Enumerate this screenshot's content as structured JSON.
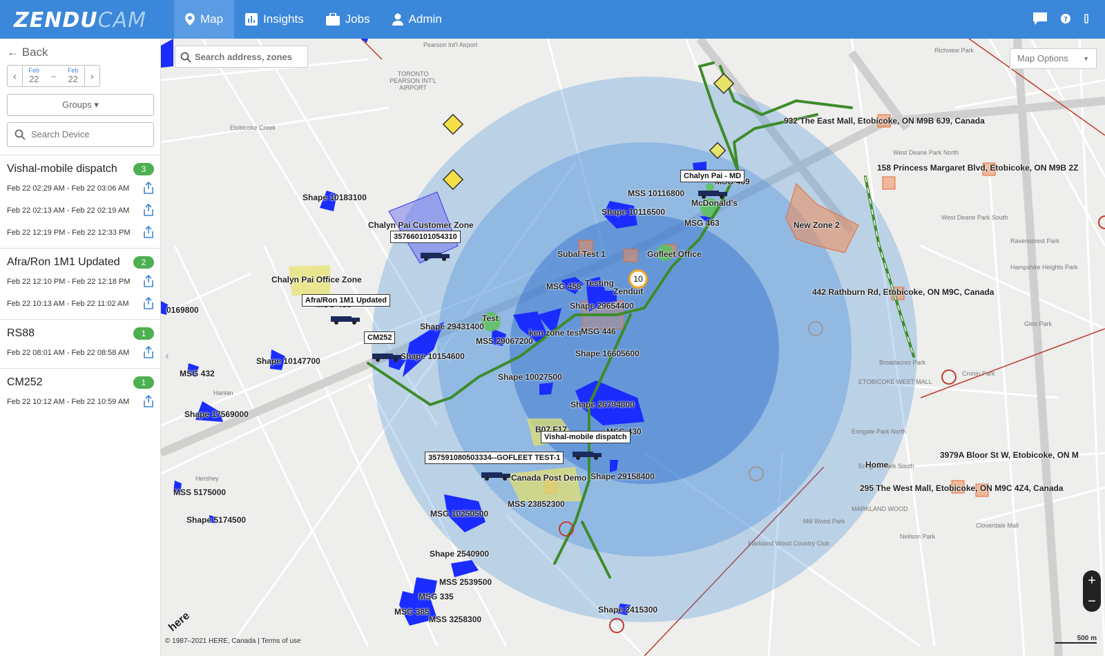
{
  "brand": {
    "name1": "ZENDU",
    "name2": "CAM"
  },
  "nav": [
    {
      "label": "Map",
      "icon": "map-pin-icon"
    },
    {
      "label": "Insights",
      "icon": "bar-chart-icon"
    },
    {
      "label": "Jobs",
      "icon": "briefcase-icon"
    },
    {
      "label": "Admin",
      "icon": "user-icon"
    }
  ],
  "sidebar": {
    "back_label": "Back",
    "date_from": {
      "month": "Feb",
      "day": "22"
    },
    "date_to": {
      "month": "Feb",
      "day": "22"
    },
    "date_sep": "–",
    "groups_label": "Groups ▾",
    "search_placeholder": "Search Device",
    "devices": [
      {
        "name": "Vishal-mobile dispatch",
        "count": "3",
        "trips": [
          "Feb 22 02:29 AM - Feb 22 03:06 AM",
          "Feb 22 02:13 AM - Feb 22 02:19 AM",
          "Feb 22 12:19 PM - Feb 22 12:33 PM"
        ]
      },
      {
        "name": "Afra/Ron 1M1 Updated",
        "count": "2",
        "trips": [
          "Feb 22 12:10 PM - Feb 22 12:18 PM",
          "Feb 22 10:13 AM - Feb 22 11:02 AM"
        ]
      },
      {
        "name": "RS88",
        "count": "1",
        "trips": [
          "Feb 22 08:01 AM - Feb 22 08:58 AM"
        ]
      },
      {
        "name": "CM252",
        "count": "1",
        "trips": [
          "Feb 22 10:12 AM - Feb 22 10:59 AM"
        ]
      }
    ]
  },
  "map": {
    "search_placeholder": "Search address, zones",
    "options_label": "Map Options",
    "zoom_in": "+",
    "zoom_out": "−",
    "copyright": "© 1987–2021 HERE, Canada | ",
    "terms": "Terms of use",
    "scale": "500 m",
    "here_logo": "here",
    "cluster_count": "10",
    "area_labels": [
      "Pearson Int'l Airport",
      "TORONTO PEARSON INT'L AIRPORT",
      "Etobicoke Creek",
      "Richview Park",
      "West Deane Park North",
      "West Deane Park South",
      "Ravenscrest Park",
      "Hampshire Heights Park",
      "Glen Park",
      "Broadacres Park",
      "ETOBICOKE WEST MALL",
      "Cronin Park",
      "Eringate Park North",
      "Eringate Park South",
      "MARKLAND WOOD",
      "Markland Wood Country Club",
      "Mill Wood Park",
      "Neilson Park",
      "Cloverdale Mall",
      "Hanlan",
      "Hershey"
    ],
    "labels": [
      "932 The East Mall, Etobicoke, ON M9B 6J9, Canada",
      "158 Princess Margaret Blvd, Etobicoke, ON M9B 2Z",
      "New Zone 2",
      "442 Rathburn Rd, Etobicoke, ON M9C, Canada",
      "3979A Bloor St W, Etobicoke, ON M",
      "Home",
      "295 The West Mall, Etobicoke, ON M9C 4Z4, Canada",
      "Shape 10183100",
      "Chalyn Pai Customer Zone",
      "Chalyn Pai Office Zone",
      "MSG 455",
      "0169800",
      "Shape 10147700",
      "MSG 432",
      "Shape 17569000",
      "MSS 5175000",
      "Shape 5174500",
      "MSS 10116800",
      "McDonald's",
      "MSG 469",
      "Shape 10116500",
      "MSG 463",
      "Subal Test 1",
      "Gofleet Office",
      "MSG 458",
      "Testing",
      "Zenduit",
      "Shape 29654400",
      "Test",
      "Shape 29431400",
      "MSS 29067200",
      "ken zone test",
      "MSG 446",
      "Shape 10154600",
      "Shape 16605600",
      "Shape 10027500",
      "Shape 26794800",
      "B07 F17",
      "MSG 430",
      "Canada Post Demo",
      "Shape 29158400",
      "MSS 23852300",
      "MSG 10250500",
      "Shape 2540900",
      "MSS 2539500",
      "MSG 335",
      "MSG 385",
      "MSS 3258300",
      "Shape 2415300"
    ],
    "tags": [
      "Chalyn Pai - MD",
      "357660101054310",
      "Afra/Ron 1M1 Updated",
      "CM252",
      "Vishal-mobile dispatch",
      "357591080503334--GOFLEET TEST-1"
    ],
    "colors": {
      "radius": "#3b87d9",
      "zone": "#1a2cff",
      "route": "#3e8b2a",
      "orange_zone": "#f08c5a"
    }
  }
}
